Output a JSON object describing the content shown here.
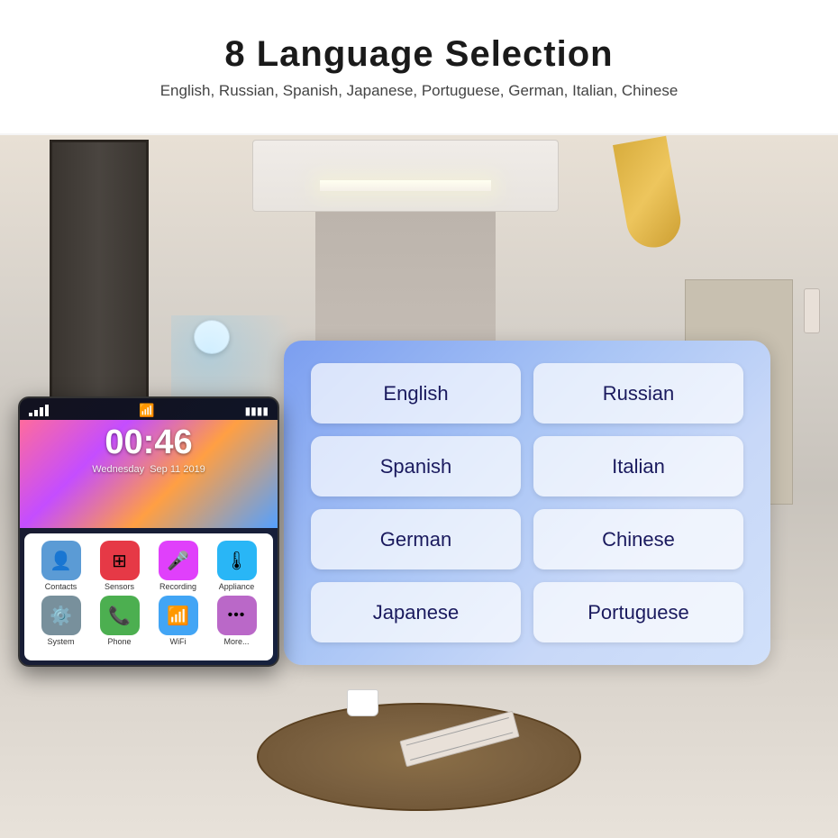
{
  "header": {
    "title": "8 Language Selection",
    "subtitle": "English, Russian, Spanish, Japanese, Portuguese, German, Italian, Chinese"
  },
  "phone": {
    "time": "00:46",
    "day": "Wednesday",
    "date": "Sep 11 2019",
    "apps": [
      {
        "label": "Contacts",
        "color": "#5b9bd5",
        "icon": "👤"
      },
      {
        "label": "Sensors",
        "color": "#e63946",
        "icon": "⊞"
      },
      {
        "label": "Recording",
        "color": "#e040fb",
        "icon": "🎤"
      },
      {
        "label": "Appliance",
        "color": "#29b6f6",
        "icon": "🌡"
      },
      {
        "label": "System",
        "color": "#78909c",
        "icon": "⚙"
      },
      {
        "label": "Phone",
        "color": "#4caf50",
        "icon": "📞"
      },
      {
        "label": "WiFi",
        "color": "#42a5f5",
        "icon": "📶"
      },
      {
        "label": "More...",
        "color": "#ba68c8",
        "icon": "···"
      }
    ]
  },
  "languages": {
    "buttons": [
      "English",
      "Russian",
      "Spanish",
      "Italian",
      "German",
      "Chinese",
      "Japanese",
      "Portuguese"
    ]
  }
}
